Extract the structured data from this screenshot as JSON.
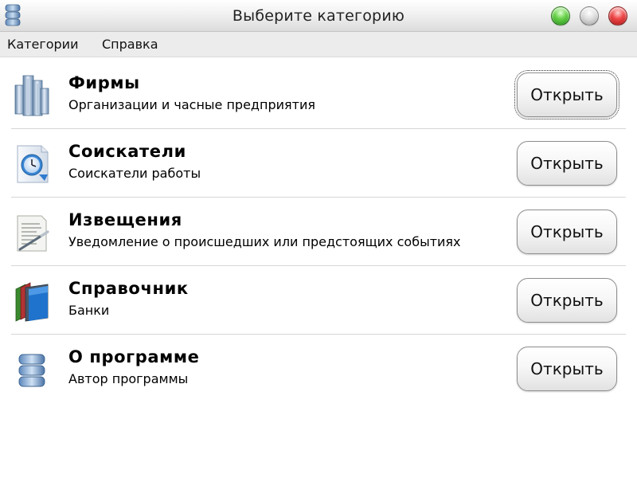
{
  "window": {
    "title": "Выберите категорию",
    "controls": [
      "green-zoom-button",
      "gray-minimize-button",
      "red-close-button"
    ]
  },
  "menubar": {
    "items": [
      "Категории",
      "Справка"
    ]
  },
  "categories": [
    {
      "title": "Фирмы",
      "description": "Организации и часные предприятия",
      "button": "Открыть",
      "icon": "buildings-icon",
      "focused": true
    },
    {
      "title": "Соискатели",
      "description": "Соискатели работы",
      "button": "Открыть",
      "icon": "clock-icon",
      "focused": false
    },
    {
      "title": "Извещения",
      "description": "Уведомление о происшедших или предстоящих событиях",
      "button": "Открыть",
      "icon": "document-pen-icon",
      "focused": false
    },
    {
      "title": "Справочник",
      "description": "Банки",
      "button": "Открыть",
      "icon": "books-icon",
      "focused": false
    },
    {
      "title": "О программе",
      "description": "Автор программы",
      "button": "Открыть",
      "icon": "database-icon",
      "focused": false
    }
  ],
  "colors": {
    "title_bar": "#e4e4e4",
    "menu_bar": "#ececec",
    "divider": "#d6d6d6",
    "button_border": "#8e8e8e"
  }
}
